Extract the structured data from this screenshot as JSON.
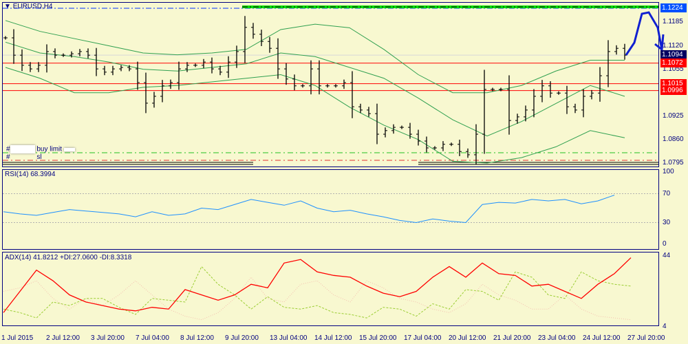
{
  "title": "EURUSD,H4",
  "price_scale": {
    "max": 1.1224,
    "min": 1.0795
  },
  "price_ticks": [
    "1.1185",
    "1.1120",
    "1.1055",
    "1.0925",
    "1.0860",
    "1.0795"
  ],
  "price_tags": [
    {
      "text": "1.1224",
      "price": 1.1224,
      "color": "#0050ff"
    },
    {
      "text": "1.1094",
      "price": 1.1094,
      "color": "#000060"
    },
    {
      "text": "1.1072",
      "price": 1.1072,
      "color": "#ff0000"
    },
    {
      "text": "1.1015",
      "price": 1.1015,
      "color": "#ff0000"
    },
    {
      "text": "1.0996",
      "price": 1.0996,
      "color": "#ff0000"
    }
  ],
  "hlines": [
    {
      "price": 1.1072,
      "color": "#ff0000"
    },
    {
      "price": 1.1015,
      "color": "#ff0000"
    },
    {
      "price": 1.0996,
      "color": "#ff0000"
    }
  ],
  "orders": {
    "buy_limit_label": "buy limit",
    "buy_limit_price": 1.0823,
    "sl_label": "sl",
    "sl_price": 1.0804,
    "hash": "#"
  },
  "closes": [
    1.1142,
    1.1094,
    1.1066,
    1.1056,
    1.1066,
    1.1104,
    1.1094,
    1.1094,
    1.1098,
    1.1104,
    1.1094,
    1.1056,
    1.1047,
    1.1056,
    1.106,
    1.1056,
    1.1018,
    1.0961,
    1.098,
    1.1009,
    1.1018,
    1.1056,
    1.1066,
    1.1066,
    1.1075,
    1.1056,
    1.1047,
    1.1075,
    1.1104,
    1.1171,
    1.1152,
    1.1132,
    1.1113,
    1.1056,
    1.1028,
    1.1009,
    1.1009,
    1.1056,
    1.1009,
    1.1009,
    1.1009,
    1.1018,
    1.0951,
    1.0942,
    1.0932,
    1.0875,
    1.0885,
    1.0894,
    1.0894,
    1.0875,
    1.0856,
    1.0837,
    1.0837,
    1.0847,
    1.0847,
    1.0827,
    1.0818,
    1.0875,
    1.0999,
    1.0999,
    1.0999,
    1.0913,
    1.0923,
    1.0942,
    1.098,
    1.1009,
    1.0989,
    1.0989,
    1.0951,
    1.0942,
    1.098,
    1.0989,
    1.1037,
    1.1104,
    1.1113,
    1.1094
  ],
  "bb_upper": [
    1.119,
    1.116,
    1.114,
    1.112,
    1.11,
    1.1095,
    1.11,
    1.111,
    1.1165,
    1.118,
    1.117,
    1.111,
    1.104,
    1.099,
    1.099,
    1.101,
    1.105,
    1.108,
    1.108
  ],
  "bb_mid": [
    1.113,
    1.11,
    1.109,
    1.1075,
    1.1055,
    1.105,
    1.106,
    1.107,
    1.11,
    1.109,
    1.106,
    1.103,
    1.0975,
    1.0915,
    1.087,
    1.091,
    1.096,
    1.101,
    1.098
  ],
  "bb_lower": [
    1.106,
    1.103,
    1.099,
    1.099,
    1.1005,
    1.101,
    1.102,
    1.103,
    1.104,
    1.101,
    1.095,
    1.09,
    1.086,
    1.08,
    1.0795,
    1.081,
    1.084,
    1.0885,
    1.0865
  ],
  "rsi": {
    "label": "RSI(14) 68.3994",
    "ticks": [
      "100",
      "70",
      "30",
      "0"
    ],
    "values": [
      45,
      42,
      40,
      44,
      48,
      46,
      44,
      42,
      38,
      45,
      40,
      42,
      50,
      48,
      55,
      62,
      58,
      54,
      60,
      50,
      45,
      47,
      42,
      38,
      33,
      30,
      35,
      32,
      30,
      55,
      58,
      57,
      62,
      60,
      62,
      56,
      60,
      68
    ]
  },
  "adx": {
    "label": "ADX(14) 41.8212 +DI:27.0600 -DI:8.3318",
    "ticks": [
      "44",
      "4"
    ],
    "range": [
      4,
      44
    ],
    "adx": [
      12,
      24,
      36,
      30,
      22,
      18,
      16,
      14,
      13,
      15,
      14,
      25,
      22,
      19,
      22,
      28,
      26,
      40,
      42,
      35,
      33,
      32,
      27,
      23,
      21,
      24,
      32,
      38,
      32,
      40,
      34,
      33,
      27,
      28,
      24,
      20,
      28,
      34,
      43
    ],
    "plus_di": [
      14,
      12,
      9,
      18,
      16,
      20,
      20,
      15,
      11,
      20,
      19,
      18,
      38,
      28,
      22,
      14,
      21,
      15,
      14,
      16,
      12,
      11,
      9,
      15,
      14,
      10,
      17,
      14,
      25,
      24,
      19,
      35,
      32,
      22,
      20,
      35,
      30,
      28,
      27
    ],
    "minus_di": [
      24,
      26,
      30,
      20,
      14,
      20,
      16,
      22,
      30,
      22,
      14,
      10,
      8,
      12,
      20,
      32,
      20,
      18,
      28,
      30,
      22,
      18,
      30,
      26,
      20,
      18,
      14,
      12,
      17,
      28,
      22,
      19,
      14,
      14,
      22,
      14,
      10,
      9,
      8
    ]
  },
  "time_labels": [
    "1 Jul 2015",
    "2 Jul 12:00",
    "3 Jul 20:00",
    "7 Jul 04:00",
    "8 Jul 12:00",
    "9 Jul 20:00",
    "13 Jul 04:00",
    "14 Jul 12:00",
    "15 Jul 20:00",
    "17 Jul 04:00",
    "20 Jul 12:00",
    "21 Jul 20:00",
    "23 Jul 04:00",
    "24 Jul 12:00",
    "27 Jul 20:00"
  ]
}
